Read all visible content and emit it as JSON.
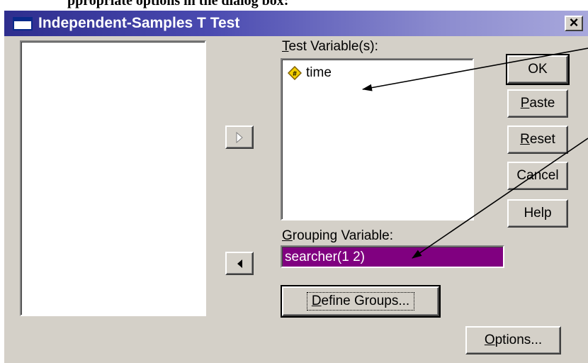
{
  "top_caption": "ppropriate options in the dialog box:",
  "dialog": {
    "title": "Independent-Samples T Test",
    "close_label": "×"
  },
  "test_variables": {
    "label_prefix": "",
    "label_accel": "T",
    "label_rest": "est Variable(s):",
    "items": [
      {
        "name": "time",
        "icon": "scale-variable-icon"
      }
    ]
  },
  "grouping_variable": {
    "label_accel": "G",
    "label_rest": "rouping Variable:",
    "value": "searcher(1 2)"
  },
  "buttons": {
    "ok": "OK",
    "paste_accel": "P",
    "paste_rest": "aste",
    "reset_accel": "R",
    "reset_rest": "eset",
    "cancel": "Cancel",
    "help": "Help",
    "define_accel": "D",
    "define_rest": "efine Groups...",
    "options_accel": "O",
    "options_rest": "ptions...",
    "move_right_icon": "right-triangle-icon",
    "move_left_icon": "left-triangle-icon"
  },
  "colors": {
    "titlebar_start": "#2e2e8e",
    "selection": "#800080",
    "face": "#d4d0c8"
  }
}
